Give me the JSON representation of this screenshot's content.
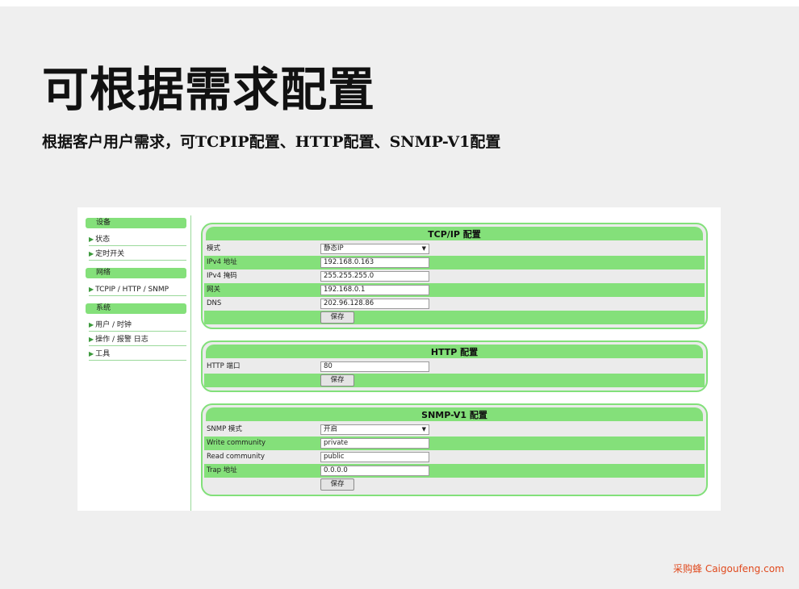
{
  "headline": "可根据需求配置",
  "subline": "根据客户用户需求，可TCPIP配置、HTTP配置、SNMP-V1配置",
  "sidebar": {
    "sections": [
      {
        "title": "设备",
        "items": [
          "状态",
          "定时开关"
        ]
      },
      {
        "title": "网络",
        "items": [
          "TCPIP / HTTP / SNMP"
        ]
      },
      {
        "title": "系统",
        "items": [
          "用户 / 时钟",
          "操作 / 报警 日志",
          "工具"
        ]
      }
    ]
  },
  "tcpip": {
    "title": "TCP/IP 配置",
    "rows": [
      {
        "label": "模式",
        "value": "静态IP"
      },
      {
        "label": "IPv4 地址",
        "value": "192.168.0.163"
      },
      {
        "label": "IPv4 掩码",
        "value": "255.255.255.0"
      },
      {
        "label": "网关",
        "value": "192.168.0.1"
      },
      {
        "label": "DNS",
        "value": "202.96.128.86"
      }
    ],
    "save": "保存"
  },
  "http": {
    "title": "HTTP 配置",
    "rows": [
      {
        "label": "HTTP 端口",
        "value": "80"
      }
    ],
    "save": "保存"
  },
  "snmp": {
    "title": "SNMP-V1 配置",
    "rows": [
      {
        "label": "SNMP 模式",
        "value": "开启"
      },
      {
        "label": "Write community",
        "value": "private"
      },
      {
        "label": "Read community",
        "value": "public"
      },
      {
        "label": "Trap 地址",
        "value": "0.0.0.0"
      }
    ],
    "save": "保存"
  },
  "watermark": "采购蜂 Caigoufeng.com",
  "colors": {
    "accent_green": "#84e07a",
    "watermark": "#e04a1e"
  }
}
